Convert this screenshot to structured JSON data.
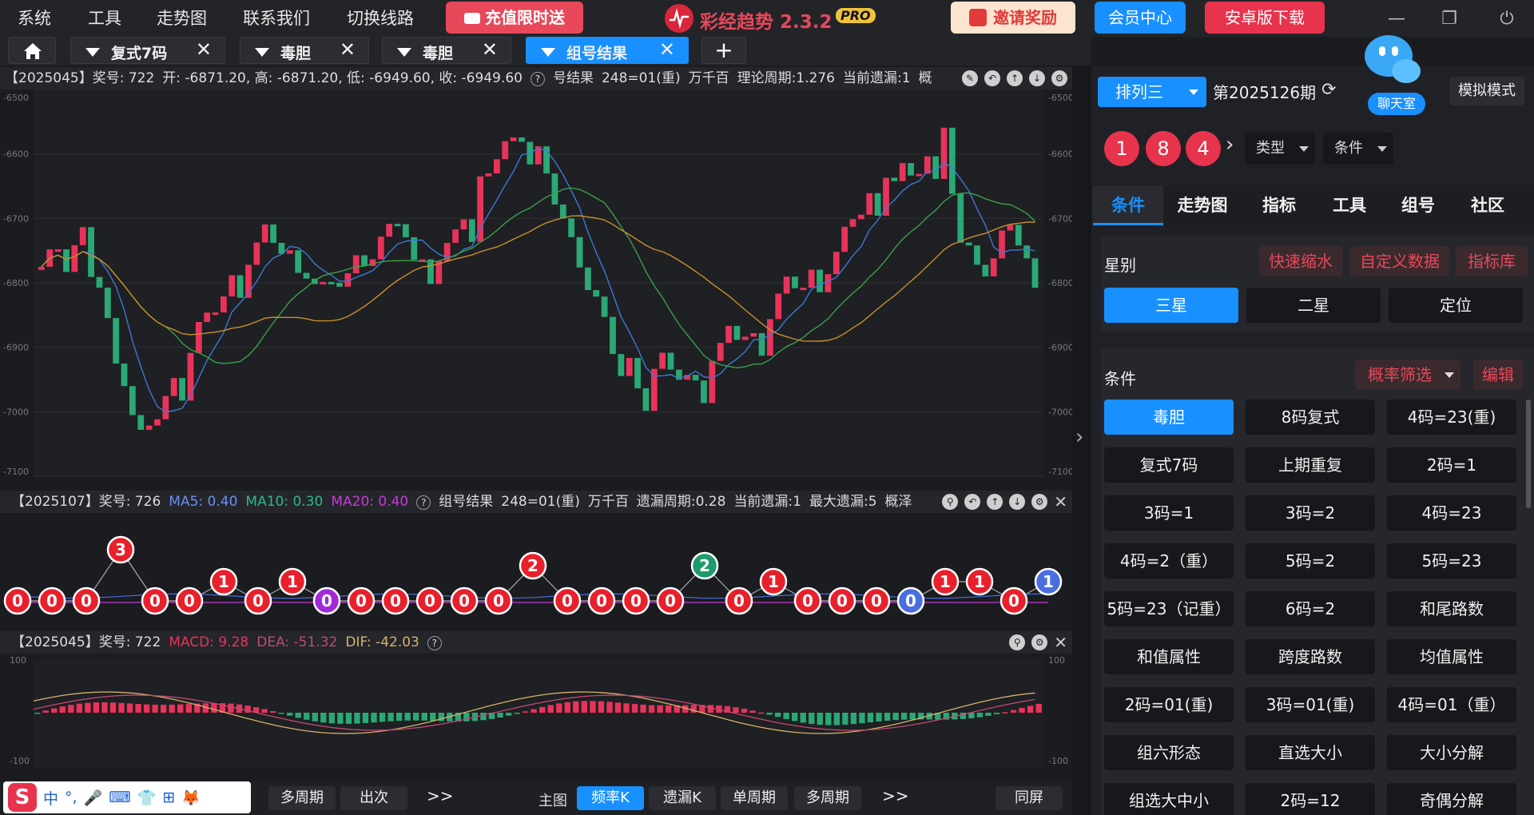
{
  "menu": {
    "items": [
      "系统",
      "工具",
      "走势图",
      "联系我们",
      "切换线路"
    ],
    "promo": "充值限时送",
    "app_title": "彩经趋势 2.3.2",
    "pro": "PRO",
    "invite": "邀请奖励",
    "member": "会员中心",
    "android": "安卓版下载"
  },
  "tabs": [
    {
      "label": "复式7码"
    },
    {
      "label": "毒胆"
    },
    {
      "label": "毒胆"
    },
    {
      "label": "组号结果"
    }
  ],
  "panel1": {
    "header": [
      "【2025045】奖号: 722",
      "开: -6871.20, 高: -6871.20, 低: -6949.60, 收: -6949.60",
      "?",
      "号结果",
      "248=01(重)",
      "万千百",
      "理论周期:1.276",
      "当前遗漏:1",
      "概"
    ],
    "y_labels": [
      "-6500",
      "-6600",
      "-6700",
      "-6800",
      "-6900",
      "-7000",
      "-7100"
    ]
  },
  "panel2": {
    "header": {
      "period": "【2025107】奖号: 726",
      "ma5": "MA5: 0.40",
      "ma10": "MA10: 0.30",
      "ma20": "MA20: 0.40",
      "q": "?",
      "rest": [
        "组号结果",
        "248=01(重)",
        "万千百",
        "遗漏周期:0.28",
        "当前遗漏:1",
        "最大遗漏:5",
        "概泽"
      ]
    }
  },
  "panel3": {
    "header": {
      "period": "【2025045】奖号: 722",
      "macd": "MACD: 9.28",
      "dea": "DEA: -51.32",
      "dif": "DIF: -42.03",
      "q": "?"
    },
    "y_labels": [
      "100",
      "-100"
    ]
  },
  "chart_data": [
    {
      "type": "candlestick",
      "y_ticks": [
        -6500,
        -6600,
        -6700,
        -6800,
        -6900,
        -7000,
        -7100
      ],
      "ylim": [
        -7100,
        -6500
      ],
      "legend": {
        "color_up": "#e8335a",
        "color_down": "#2aa876"
      }
    },
    {
      "type": "scatter",
      "labels": [
        0,
        0,
        0,
        3,
        0,
        0,
        1,
        0,
        1,
        0,
        0,
        0,
        0,
        0,
        0,
        2,
        0,
        0,
        0,
        0,
        2,
        0,
        1,
        0,
        0,
        0,
        0,
        1,
        1,
        0,
        1
      ]
    },
    {
      "type": "bar",
      "y_ticks": [
        100,
        -100
      ]
    }
  ],
  "bottom": {
    "ime": [
      "中",
      "°,",
      "🎤",
      "⌨",
      "👕",
      "⊞",
      "🦊"
    ],
    "left_buttons": [
      "多周期",
      "出次"
    ],
    "more": ">>",
    "main_label": "主图",
    "right_buttons": [
      "频率K",
      "遗漏K",
      "单周期",
      "多周期"
    ],
    "more2": ">>",
    "tongping": "同屏"
  },
  "right": {
    "chatroom": "聊天室",
    "mode": "模拟模式",
    "lottery": "排列三",
    "issue": "第2025126期",
    "balls": [
      "1",
      "8",
      "4"
    ],
    "type_dd": "类型",
    "cond_dd": "条件",
    "tabs": [
      "条件",
      "走势图",
      "指标",
      "工具",
      "组号",
      "社区"
    ],
    "star_label": "星别",
    "star_btns": [
      "快速缩水",
      "自定义数据",
      "指标库"
    ],
    "star_opts": [
      "三星",
      "二星",
      "定位"
    ],
    "cond_label": "条件",
    "filter": "概率筛选",
    "edit": "编辑",
    "conds": [
      "毒胆",
      "8码复式",
      "4码=23(重)",
      "复式7码",
      "上期重复",
      "2码=1",
      "3码=1",
      "3码=2",
      "4码=23",
      "4码=2（重）",
      "5码=2",
      "5码=23",
      "5码=23（记重）",
      "6码=2",
      "和尾路数",
      "和值属性",
      "跨度路数",
      "均值属性",
      "2码=01(重)",
      "3码=01(重)",
      "4码=01（重）",
      "组六形态",
      "直选大小",
      "大小分解",
      "组选大中小",
      "2码=12",
      "奇偶分解"
    ]
  },
  "colors": {
    "accent": "#1890ff",
    "red": "#e8334c",
    "green": "#1e9b6a"
  }
}
